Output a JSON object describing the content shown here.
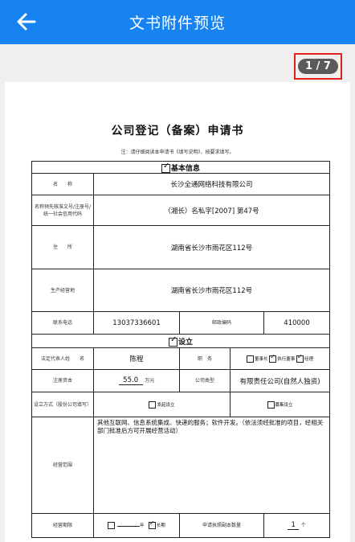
{
  "header": {
    "title": "文书附件预览"
  },
  "pager": {
    "text": "1 / 7"
  },
  "document": {
    "title": "公司登记（备案）申请书",
    "note": "注：请仔细阅读本申请书《填写说明》，按要求填写。",
    "basic_section": "基本信息",
    "name_label": "名　　称",
    "name_value": "长沙全通网络科技有限公司",
    "preapproval_label": "名称预先核准文号/注册号/统一社会信用代码",
    "preapproval_value": "（湘长）名私字[2007] 第47号",
    "address_label": "住　　所",
    "address_value": "湖南省长沙市雨花区112号",
    "biz_address_label": "生产经营地",
    "biz_address_value": "湖南省长沙市雨花区112号",
    "phone_label": "联系电话",
    "phone_value": "13037336601",
    "postcode_label": "邮政编码",
    "postcode_value": "410000",
    "setup_section": "设立",
    "legal_rep_label": "法定代表人姓　　名",
    "legal_rep_value": "陈程",
    "position_label": "职　务",
    "position_options": [
      "董事长",
      "执行董事",
      "经理"
    ],
    "capital_label": "注册资本",
    "capital_value": "55.0",
    "capital_unit": "万元",
    "company_type_label": "公司类型",
    "company_type_value": "有限责任公司(自然人独资)",
    "setup_method_label": "设立方式（股份公司填写）",
    "setup_method_options": [
      "发起设立",
      "募集设立"
    ],
    "scope_label": "经营范围",
    "scope_value": "其他互联网、信息系统集成、快递的服务；软件开发。（依法须经批准的项目，经相关部门批准后方可开展经营活动）",
    "term_label": "经营期限",
    "term_years_unit": "年",
    "term_long_label": "长期",
    "license_count_label": "申请执照副本数量",
    "license_count_value": "1",
    "license_count_unit": "个"
  }
}
